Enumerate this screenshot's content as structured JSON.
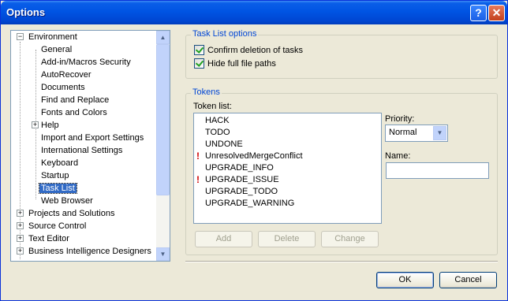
{
  "window": {
    "title": "Options",
    "help_glyph": "?",
    "close_glyph": "✕"
  },
  "tree": {
    "items": [
      {
        "label": "Environment",
        "expander": "−"
      },
      {
        "label": "General"
      },
      {
        "label": "Add-in/Macros Security"
      },
      {
        "label": "AutoRecover"
      },
      {
        "label": "Documents"
      },
      {
        "label": "Find and Replace"
      },
      {
        "label": "Fonts and Colors"
      },
      {
        "label": "Help",
        "expander": "+"
      },
      {
        "label": "Import and Export Settings"
      },
      {
        "label": "International Settings"
      },
      {
        "label": "Keyboard"
      },
      {
        "label": "Startup"
      },
      {
        "label": "Task List",
        "selected": true
      },
      {
        "label": "Web Browser"
      },
      {
        "label": "Projects and Solutions",
        "expander": "+"
      },
      {
        "label": "Source Control",
        "expander": "+"
      },
      {
        "label": "Text Editor",
        "expander": "+"
      },
      {
        "label": "Business Intelligence Designers",
        "expander": "+"
      }
    ]
  },
  "task_list_options": {
    "title": "Task List options",
    "confirm_deletion": {
      "label": "Confirm deletion of tasks",
      "checked": true
    },
    "hide_paths": {
      "label": "Hide full file paths",
      "checked": true
    }
  },
  "tokens": {
    "title": "Tokens",
    "token_list_label": "Token list:",
    "items": [
      {
        "label": "HACK",
        "warning": false
      },
      {
        "label": "TODO",
        "warning": false
      },
      {
        "label": "UNDONE",
        "warning": false
      },
      {
        "label": "UnresolvedMergeConflict",
        "warning": true
      },
      {
        "label": "UPGRADE_INFO",
        "warning": false
      },
      {
        "label": "UPGRADE_ISSUE",
        "warning": true
      },
      {
        "label": "UPGRADE_TODO",
        "warning": false
      },
      {
        "label": "UPGRADE_WARNING",
        "warning": false
      }
    ],
    "warning_glyph": "!",
    "priority_label": "Priority:",
    "priority_value": "Normal",
    "name_label": "Name:",
    "name_value": "",
    "add_label": "Add",
    "delete_label": "Delete",
    "change_label": "Change"
  },
  "footer": {
    "ok_label": "OK",
    "cancel_label": "Cancel"
  }
}
